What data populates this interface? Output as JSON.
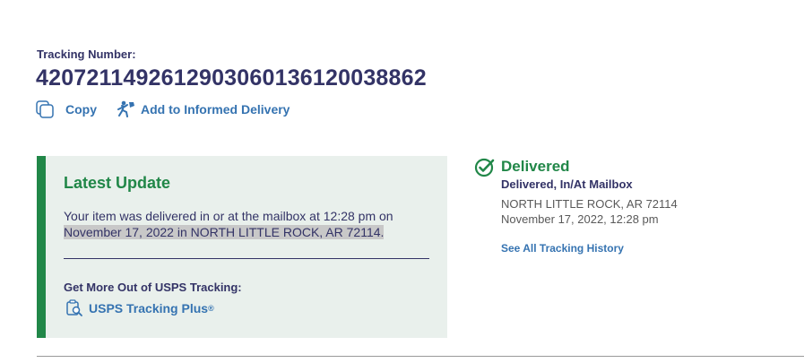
{
  "tracking": {
    "label": "Tracking Number:",
    "number": "4207211492612903060136120038862"
  },
  "actions": {
    "copy_label": "Copy",
    "informed_label": "Add to Informed Delivery"
  },
  "latest_update": {
    "title": "Latest Update",
    "text_line1": "Your item was delivered in or at the mailbox at 12:28 pm on",
    "text_line2": "November 17, 2022 in NORTH LITTLE ROCK, AR 72114.",
    "more_title": "Get More Out of USPS Tracking:",
    "plus_label": "USPS Tracking Plus",
    "plus_mark": "®"
  },
  "status": {
    "title": "Delivered",
    "subtitle": "Delivered, In/At Mailbox",
    "location": "NORTH LITTLE ROCK, AR 72114",
    "date": "November 17, 2022, 12:28 pm",
    "history_link": "See All Tracking History"
  },
  "icons": {
    "copy": "copy-icon",
    "informed": "mail-carrier-icon",
    "plus": "tracking-plus-icon",
    "status": "check-circle-icon"
  },
  "colors": {
    "navy": "#333366",
    "link_blue": "#3573b1",
    "green": "#218748",
    "card_bg": "#e9f0ec"
  }
}
